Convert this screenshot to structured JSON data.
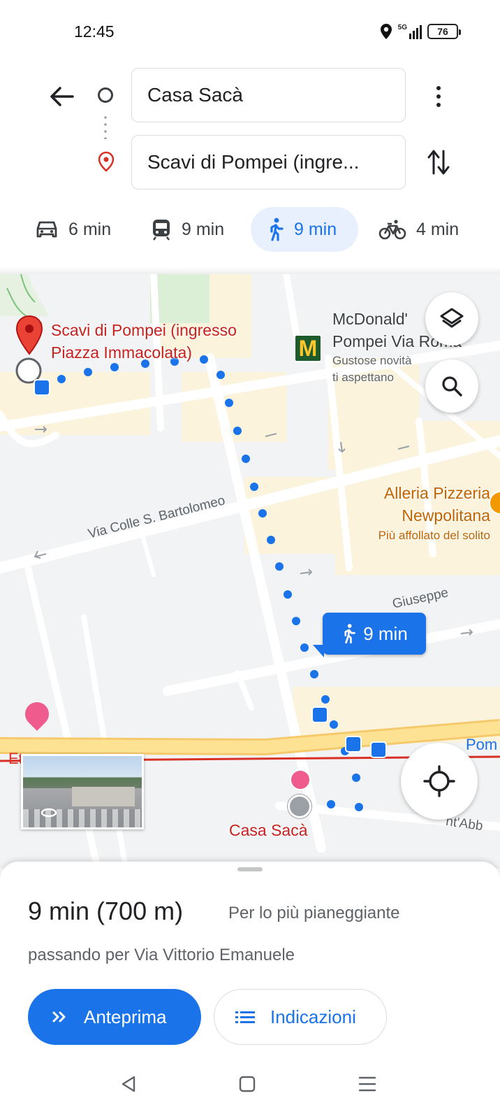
{
  "status_bar": {
    "time": "12:45",
    "network": "5G",
    "battery": "76"
  },
  "search": {
    "origin": "Casa Sacà",
    "destination": "Scavi di Pompei (ingre..."
  },
  "modes": [
    {
      "icon": "car-icon",
      "label": "6 min"
    },
    {
      "icon": "transit-icon",
      "label": "9 min"
    },
    {
      "icon": "walk-icon",
      "label": "9 min",
      "selected": true
    },
    {
      "icon": "bike-icon",
      "label": "4 min"
    }
  ],
  "map": {
    "dest_label_line1": "Scavi di Pompei (ingresso",
    "dest_label_line2": "Piazza Immacolata)",
    "mcd_line1": "McDonald'",
    "mcd_line2": "Pompei Via Roma",
    "mcd_line3": "Gustose novità",
    "mcd_line4": "ti aspettano",
    "pizzeria_line1": "Alleria Pizzeria",
    "pizzeria_line2": "Newpolitana",
    "pizzeria_line3": "Più affollato del solito",
    "street_bartolomeo": "Via Colle S. Bartolomeo",
    "street_giuseppe": "Giuseppe",
    "street_abb": "nt'Abb",
    "label_pom": "Pom",
    "label_et": "Et",
    "origin_label": "Casa Sacà",
    "route_badge": "9 min",
    "colors": {
      "route": "#1a73e8",
      "destination": "#c5221f",
      "poi_food": "#c26401"
    }
  },
  "sheet": {
    "duration": "9 min (700 m)",
    "terrain": "Per lo più pianeggiante",
    "via": "passando per Via Vittorio Emanuele",
    "preview_label": "Anteprima",
    "directions_label": "Indicazioni"
  }
}
